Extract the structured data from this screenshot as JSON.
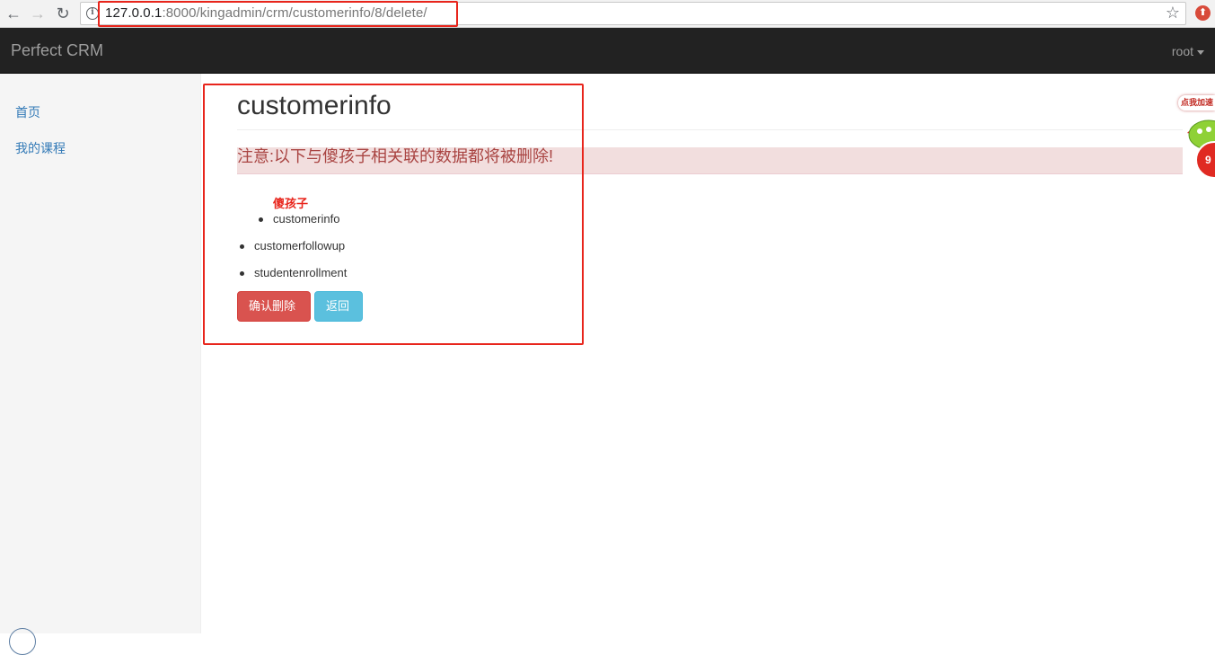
{
  "browser": {
    "url_host": "127.0.0.1",
    "url_path": ":8000/kingadmin/crm/customerinfo/8/delete/"
  },
  "navbar": {
    "brand": "Perfect CRM",
    "user": "root"
  },
  "sidebar": {
    "items": [
      {
        "label": "首页"
      },
      {
        "label": "我的课程"
      }
    ]
  },
  "main": {
    "title": "customerinfo",
    "warning": "注意:以下与傻孩子相关联的数据都将被删除!",
    "object_name": "傻孩子",
    "related": [
      "customerinfo",
      "customerfollowup",
      "studentenrollment"
    ],
    "confirm_button": "确认删除",
    "back_button": "返回"
  },
  "ad": {
    "bubble": "点我加速",
    "badge": "9"
  },
  "colors": {
    "annotation": "#e8251c",
    "danger": "#d9534f",
    "info": "#5bc0de",
    "alert_bg": "#f2dede",
    "alert_text": "#a94442"
  }
}
